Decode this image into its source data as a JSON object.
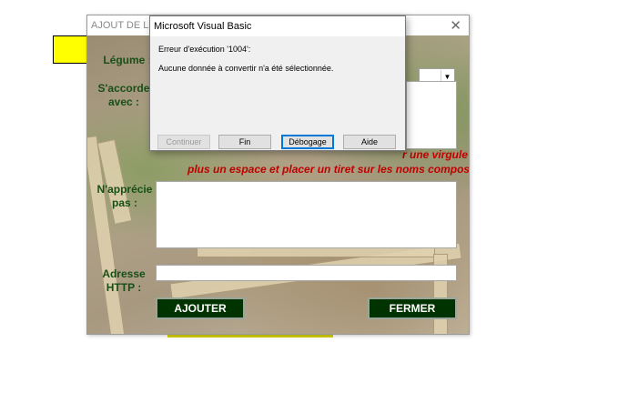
{
  "userform": {
    "title": "AJOUT DE LEGUMES",
    "close_glyph": "✕",
    "labels": {
      "legume": "Légume :",
      "saccorde_line1": "S'accorde",
      "saccorde_line2": "avec :",
      "napprecie_line1": "N'apprécie",
      "napprecie_line2": "pas :",
      "adresse_line1": "Adresse",
      "adresse_line2": "HTTP :"
    },
    "hint_line1_partial": "r une virgule",
    "hint_line2": "plus un espace et placer un tiret sur les noms composés",
    "combo_arrow": "▼",
    "buttons": {
      "ajouter": "AJOUTER",
      "fermer": "FERMER"
    },
    "colors": {
      "label": "#174f17",
      "hint": "#c00000",
      "button_bg": "#003300"
    }
  },
  "msgbox": {
    "title": "Microsoft Visual Basic",
    "error_line": "Erreur d'exécution '1004':",
    "message": "Aucune donnée à convertir n'a été sélectionnée.",
    "buttons": {
      "continuer": "Continuer",
      "fin": "Fin",
      "debogage": "Débogage",
      "aide": "Aide"
    }
  }
}
